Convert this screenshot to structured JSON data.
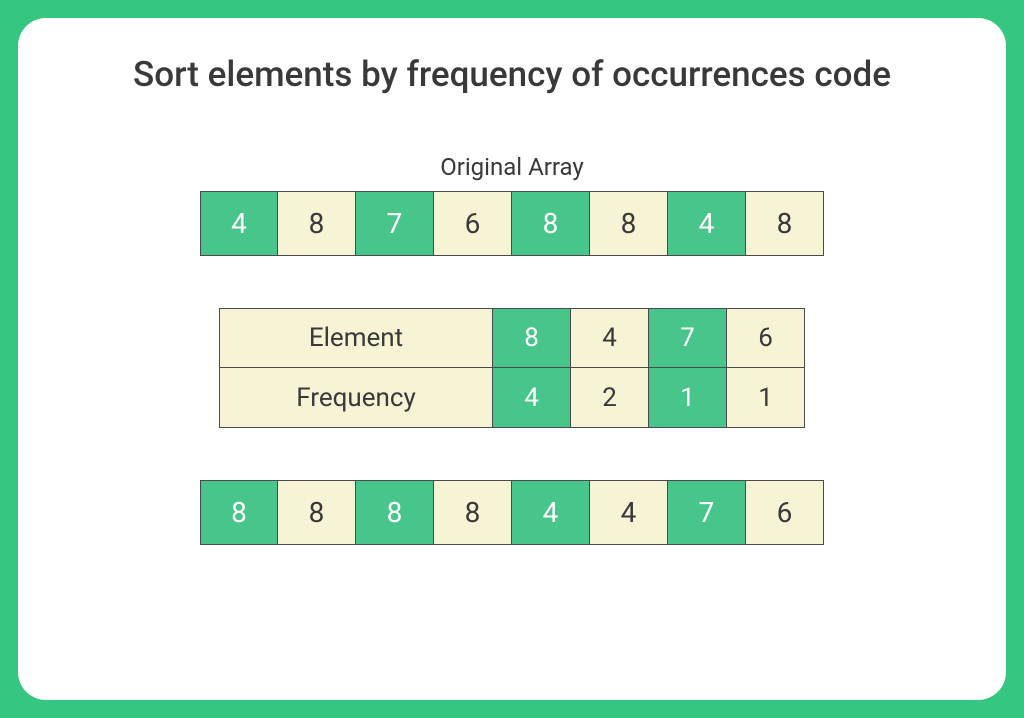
{
  "title": "Sort elements by frequency of occurrences code",
  "originalLabel": "Original Array",
  "original": [
    {
      "v": "4",
      "g": true
    },
    {
      "v": "8",
      "g": false
    },
    {
      "v": "7",
      "g": true
    },
    {
      "v": "6",
      "g": false
    },
    {
      "v": "8",
      "g": true
    },
    {
      "v": "8",
      "g": false
    },
    {
      "v": "4",
      "g": true
    },
    {
      "v": "8",
      "g": false
    }
  ],
  "freq": {
    "elementLabel": "Element",
    "frequencyLabel": "Frequency",
    "cols": [
      {
        "elem": "8",
        "count": "4",
        "g": true
      },
      {
        "elem": "4",
        "count": "2",
        "g": false
      },
      {
        "elem": "7",
        "count": "1",
        "g": true
      },
      {
        "elem": "6",
        "count": "1",
        "g": false
      }
    ]
  },
  "result": [
    {
      "v": "8",
      "g": true
    },
    {
      "v": "8",
      "g": false
    },
    {
      "v": "8",
      "g": true
    },
    {
      "v": "8",
      "g": false
    },
    {
      "v": "4",
      "g": true
    },
    {
      "v": "4",
      "g": false
    },
    {
      "v": "7",
      "g": true
    },
    {
      "v": "6",
      "g": false
    }
  ]
}
